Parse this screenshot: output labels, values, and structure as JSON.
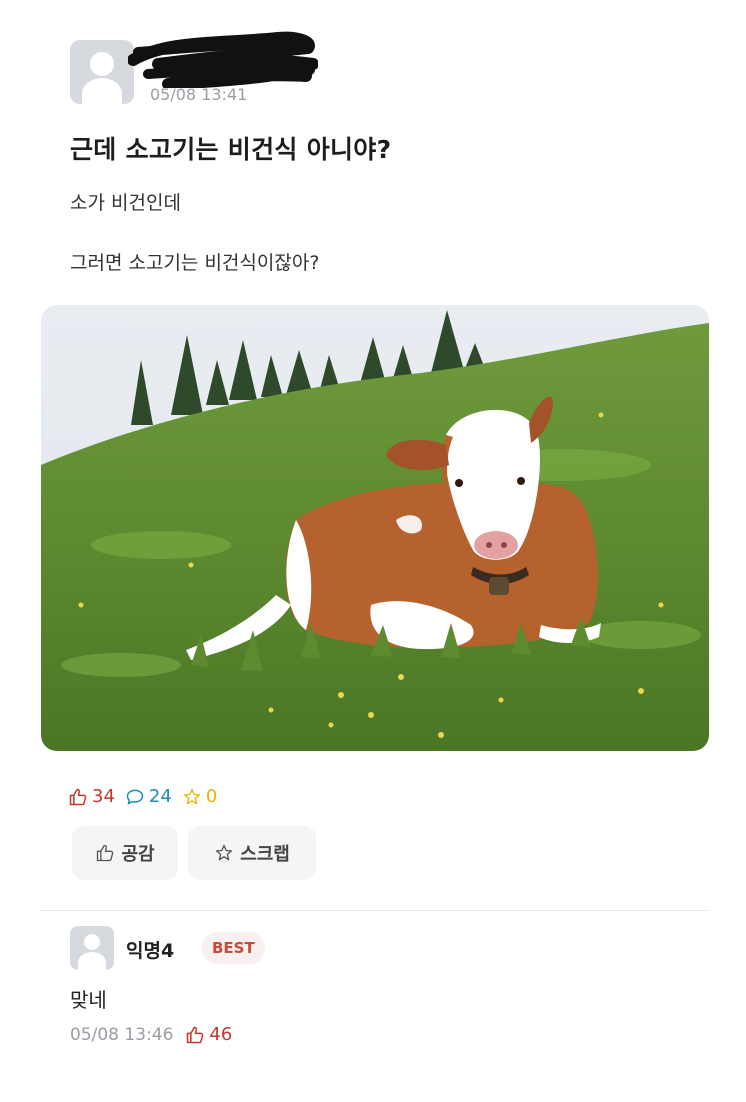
{
  "post": {
    "timestamp": "05/08 13:41",
    "title": "근데 소고기는 비건식 아니야?",
    "body_lines": [
      "소가 비건인데",
      "그러면 소고기는 비건식이잖아?"
    ],
    "image_subject": "cow lying in grass"
  },
  "stats": {
    "likes": "34",
    "comments": "24",
    "scraps": "0"
  },
  "actions": {
    "like_label": "공감",
    "scrap_label": "스크랩"
  },
  "comment": {
    "author": "익명4",
    "badge": "BEST",
    "text": "맞네",
    "timestamp": "05/08 13:46",
    "likes": "46"
  },
  "colors": {
    "like": "#c0392b",
    "comment": "#1a8fb3",
    "star": "#e6b800",
    "badge": "#c94a3a"
  },
  "icons": [
    "avatar-icon",
    "thumbs-up-icon",
    "comment-bubble-icon",
    "star-icon"
  ]
}
